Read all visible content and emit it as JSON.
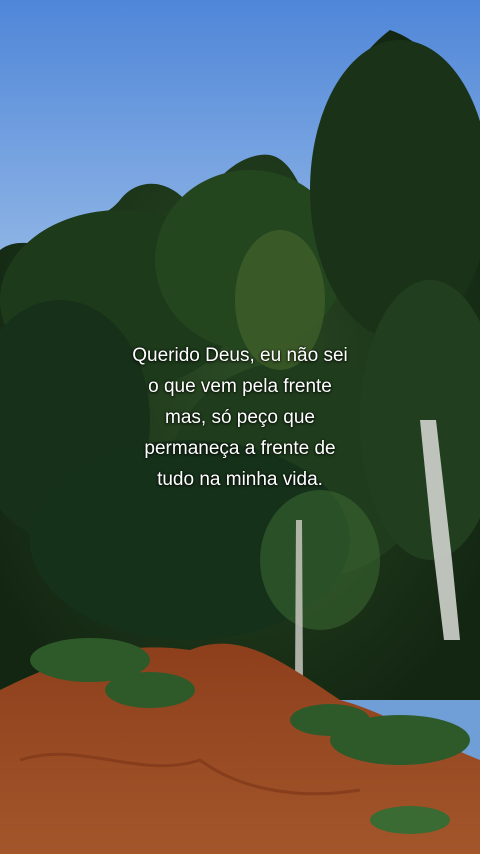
{
  "quote": {
    "lines": [
      "Querido Deus, eu não sei",
      "o que vem pela frente",
      "mas, só peço que",
      "permaneça a frente de",
      "tudo na minha vida."
    ]
  },
  "scene": {
    "sky_color_top": "#4f86d8",
    "sky_color_bottom": "#b7d2ee",
    "foliage_color": "#1f3a1c",
    "soil_color": "#9a4a22"
  }
}
